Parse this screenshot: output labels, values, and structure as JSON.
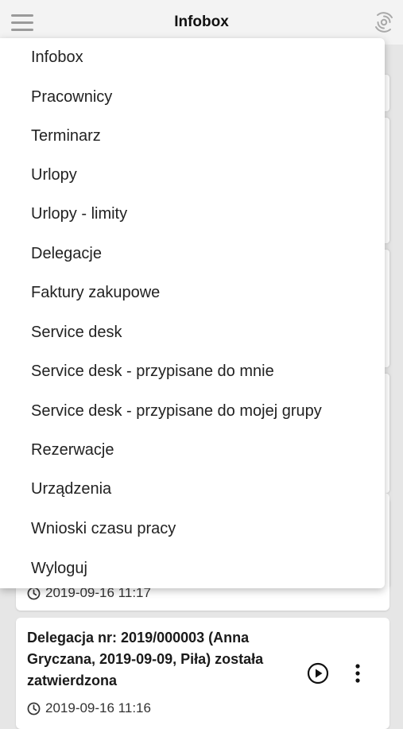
{
  "header": {
    "title": "Infobox",
    "menu_icon": "hamburger-icon",
    "refresh_icon": "refresh-icon"
  },
  "menu": {
    "items": [
      "Infobox",
      "Pracownicy",
      "Terminarz",
      "Urlopy",
      "Urlopy - limity",
      "Delegacje",
      "Faktury zakupowe",
      "Service desk",
      "Service desk - przypisane do mnie",
      "Service desk - przypisane do mojej grupy",
      "Rezerwacje",
      "Urządzenia",
      "Wnioski czasu pracy",
      "Wyloguj"
    ]
  },
  "notifications": [
    {
      "timestamp": "2019-09-16 11:17"
    },
    {
      "title": "Delegacja nr: 2019/000003 (Anna Gryczana, 2019-09-09, Piła) została zatwierdzona",
      "timestamp": "2019-09-16 11:16",
      "play_icon": "play-circle-icon",
      "more_icon": "more-vertical-icon"
    }
  ],
  "colors": {
    "background": "#e6e6e6",
    "topbar": "#f3f3f3",
    "card": "#ffffff",
    "text": "#222222"
  }
}
